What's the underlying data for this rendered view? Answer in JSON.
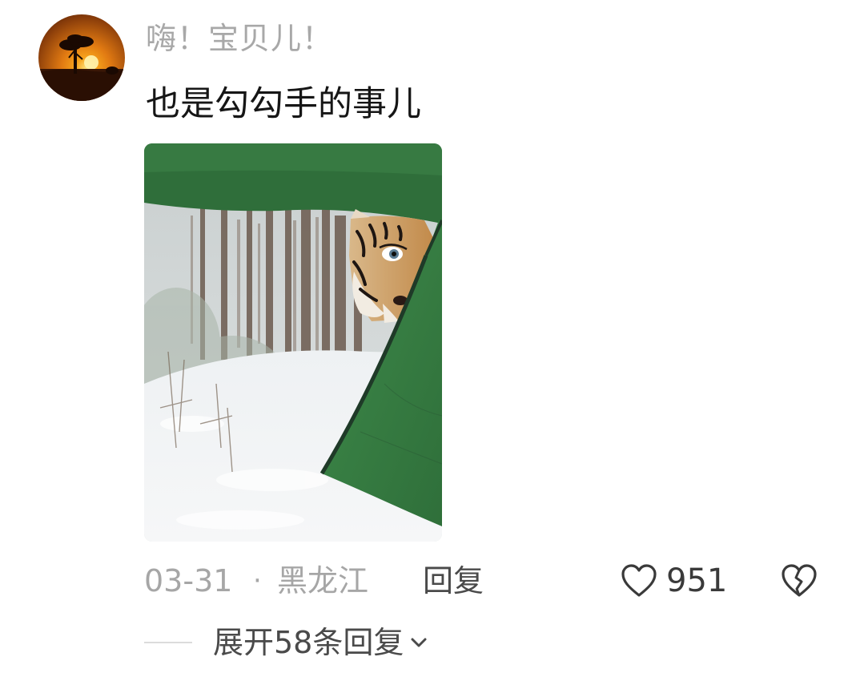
{
  "comment": {
    "username": "嗨！宝贝儿！",
    "text": "也是勾勾手的事儿",
    "avatar_icon": "sunset-tree-avatar",
    "image_icon": "tiger-peeking-tent-photo",
    "date": "03-31",
    "separator": "·",
    "location": "黑龙江",
    "reply_label": "回复",
    "like_icon": "heart-outline-icon",
    "like_count": "951",
    "dislike_icon": "broken-heart-icon"
  },
  "replies": {
    "expand_label": "展开58条回复",
    "expand_icon": "chevron-down-icon"
  }
}
